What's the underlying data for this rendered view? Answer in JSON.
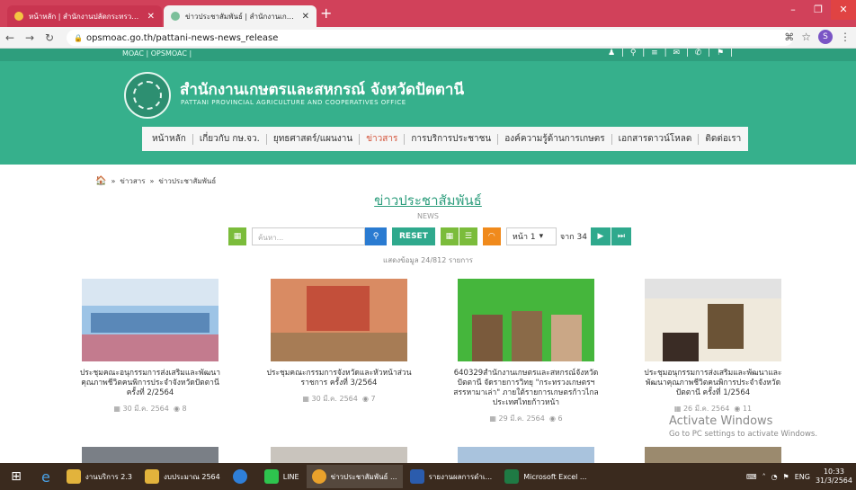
{
  "browser": {
    "tabs": [
      {
        "title": "หน้าหลัก | สำนักงานปลัดกระทรวงเกษตร",
        "active": false
      },
      {
        "title": "ข่าวประชาสัมพันธ์ | สำนักงานเกษตรและ",
        "active": true
      }
    ],
    "url": "opsmoac.go.th/pattani-news-news_release",
    "profile_initial": "S"
  },
  "site": {
    "top_links": "MOAC  |  OPSMOAC  |",
    "title": "สำนักงานเกษตรและสหกรณ์ จังหวัดปัตตานี",
    "subtitle": "PATTANI PROVINCIAL AGRICULTURE AND COOPERATIVES OFFICE",
    "menu": [
      {
        "label": "หน้าหลัก",
        "active": false
      },
      {
        "label": "เกี่ยวกับ กษ.จว.",
        "active": false
      },
      {
        "label": "ยุทธศาสตร์/แผนงาน",
        "active": false
      },
      {
        "label": "ข่าวสาร",
        "active": true
      },
      {
        "label": "การบริการประชาชน",
        "active": false
      },
      {
        "label": "องค์ความรู้ด้านการเกษตร",
        "active": false
      },
      {
        "label": "เอกสารดาวน์โหลด",
        "active": false
      },
      {
        "label": "ติดต่อเรา",
        "active": false
      }
    ]
  },
  "breadcrumb": [
    "ข่าวสาร",
    "ข่าวประชาสัมพันธ์"
  ],
  "page": {
    "heading": "ข่าวประชาสัมพันธ์",
    "subheading": "NEWS",
    "search_placeholder": "ค้นหา...",
    "reset_label": "RESET",
    "page_label": "หน้า 1",
    "of_label": "จาก 34",
    "showing": "แสดงข้อมูล 24/812 รายการ"
  },
  "news": [
    {
      "title": "ประชุมคณะอนุกรรมการส่งเสริมและพัฒนาคุณภาพชีวิตคนพิการประจำจังหวัดปัตตานี ครั้งที่ 2/2564",
      "date": "30 มี.ค. 2564",
      "views": "8"
    },
    {
      "title": "ประชุมคณะกรรมการจังหวัดและหัวหน้าส่วนราชการ ครั้งที่ 3/2564",
      "date": "30 มี.ค. 2564",
      "views": "7"
    },
    {
      "title": "640329สำนักงานเกษตรและสหกรณ์จังหวัดปัตตานี จัดรายการวิทยุ \"กระทรวงเกษตรฯ สรรหามาเล่า\" ภายใต้รายการเกษตรก้าวไกล ประเทศไทยก้าวหน้า",
      "date": "29 มี.ค. 2564",
      "views": "6"
    },
    {
      "title": "ประชุมอนุกรรมการส่งเสริมและพัฒนาและพัฒนาคุณภาพชีวิตคนพิการประจำจังหวัดปัตตานี ครั้งที่ 1/2564",
      "date": "26 มี.ค. 2564",
      "views": "11"
    }
  ],
  "watermark": {
    "line1": "Activate Windows",
    "line2": "Go to PC settings to activate Windows."
  },
  "taskbar": {
    "apps": [
      {
        "label": "งานบริการ 2.3",
        "color": "#e2b33c"
      },
      {
        "label": "งบประมาณ 2564",
        "color": "#e2b33c"
      },
      {
        "label": "",
        "color": "#2f7fd8"
      },
      {
        "label": "LINE",
        "color": "#2ec44e"
      },
      {
        "label": "ข่าวประชาสัมพันธ์ ...",
        "color": "#e9a12b"
      },
      {
        "label": "รายงานผลการดำเ...",
        "color": "#2b5cad"
      },
      {
        "label": "Microsoft Excel ...",
        "color": "#1f7a44"
      }
    ],
    "lang": "ENG",
    "time": "10:33",
    "date": "31/3/2564"
  },
  "colors": {
    "accent": "#36b08c",
    "menu_active": "#d4543b",
    "heading": "#2e9e7d"
  }
}
